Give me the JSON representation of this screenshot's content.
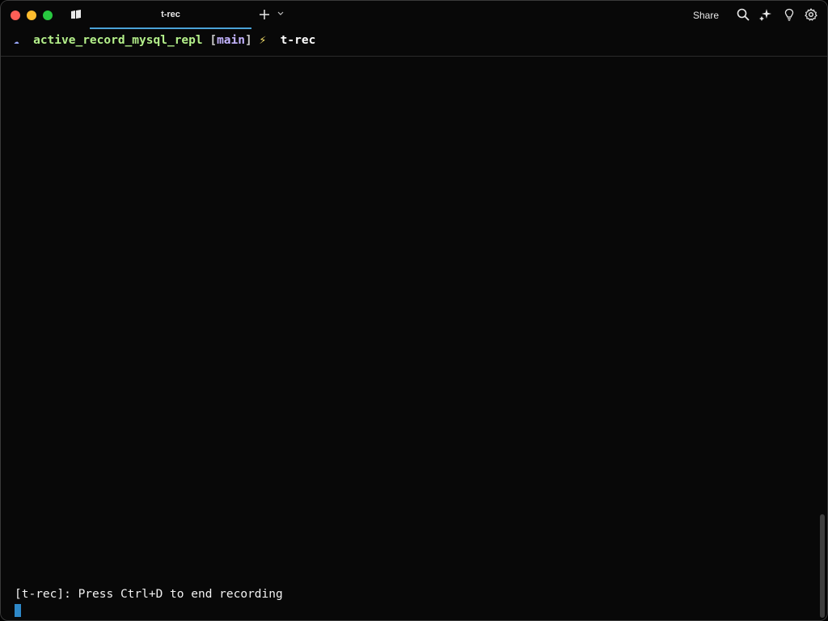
{
  "tab": {
    "title": "t-rec"
  },
  "toolbar": {
    "share_label": "Share",
    "icons": [
      "search-icon",
      "ai-sparkle-icon",
      "lightbulb-icon",
      "gear-icon"
    ]
  },
  "prompt": {
    "cloud": "☁",
    "directory": "active_record_mysql_repl",
    "branch_open": "[",
    "branch": "main",
    "branch_close": "]",
    "bolt": "⚡",
    "command": "t-rec"
  },
  "terminal": {
    "output": "[t-rec]: Press Ctrl+D to end recording"
  },
  "colors": {
    "accent": "#4aa3d8",
    "directory": "#b4f08a",
    "branch": "#c3b3ff",
    "cursor": "#2e88c8"
  }
}
